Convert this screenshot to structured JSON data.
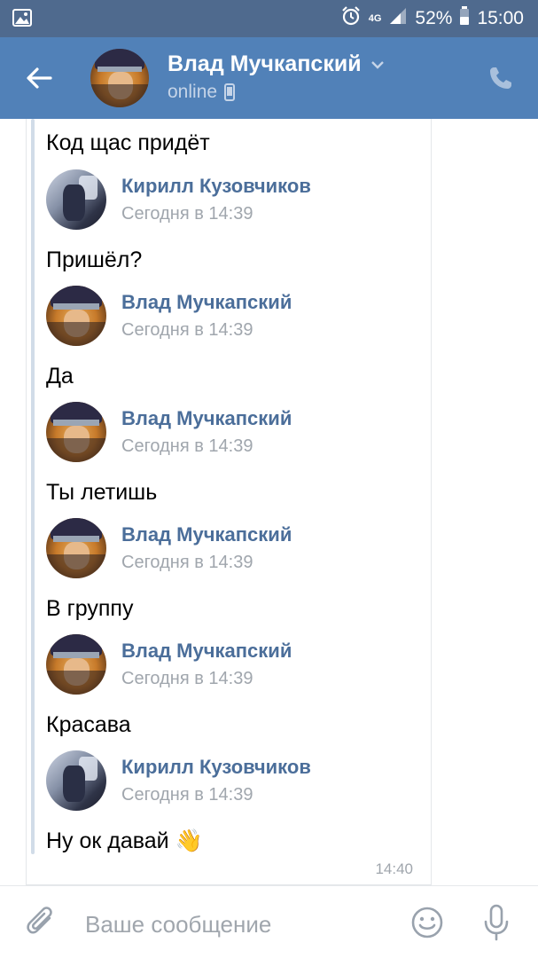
{
  "status_bar": {
    "network": "4G",
    "battery_percent": "52%",
    "time": "15:00"
  },
  "header": {
    "title": "Влад Мучкапский",
    "status": "online"
  },
  "messages": [
    {
      "type": "text",
      "text": "Код щас придёт"
    },
    {
      "type": "author",
      "name": "Кирилл Кузовчиков",
      "time": "Сегодня в 14:39",
      "avatar": "kirill"
    },
    {
      "type": "text",
      "text": "Пришёл?"
    },
    {
      "type": "author",
      "name": "Влад Мучкапский",
      "time": "Сегодня в 14:39",
      "avatar": "vlad"
    },
    {
      "type": "text",
      "text": "Да"
    },
    {
      "type": "author",
      "name": "Влад Мучкапский",
      "time": "Сегодня в 14:39",
      "avatar": "vlad"
    },
    {
      "type": "text",
      "text": "Ты летишь"
    },
    {
      "type": "author",
      "name": "Влад Мучкапский",
      "time": "Сегодня в 14:39",
      "avatar": "vlad"
    },
    {
      "type": "text",
      "text": "В группу"
    },
    {
      "type": "author",
      "name": "Влад Мучкапский",
      "time": "Сегодня в 14:39",
      "avatar": "vlad"
    },
    {
      "type": "text",
      "text": "Красава"
    },
    {
      "type": "author",
      "name": "Кирилл Кузовчиков",
      "time": "Сегодня в 14:39",
      "avatar": "kirill"
    },
    {
      "type": "text",
      "text": "Ну ок давай 👋"
    }
  ],
  "message_time": "14:40",
  "composer": {
    "placeholder": "Ваше сообщение"
  },
  "colors": {
    "status_bar": "#4f6a8e",
    "header": "#5181b8",
    "author_name": "#4b6e9a",
    "muted": "#a0a6ad"
  }
}
